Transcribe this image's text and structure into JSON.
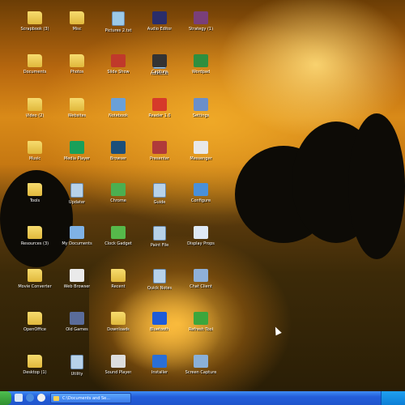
{
  "desktop": {
    "icons": [
      {
        "label": "Scrapbook (3)",
        "icon": "folder-icon",
        "color": "#e9c34b"
      },
      {
        "label": "Misc",
        "icon": "folder-icon",
        "color": "#e9c34b"
      },
      {
        "label": "Pictures 2.txt",
        "icon": "document-icon",
        "color": "#9cc9e8"
      },
      {
        "label": "Audio Editor",
        "icon": "app-icon",
        "color": "#2a2d6a"
      },
      {
        "label": "Strategy (1)",
        "icon": "app-icon",
        "color": "#7a3f7a"
      },
      {
        "label": "Documents",
        "icon": "folder-icon",
        "color": "#e9c34b"
      },
      {
        "label": "Photos",
        "icon": "folder-icon",
        "color": "#e9c34b"
      },
      {
        "label": "Slide Show",
        "icon": "app-icon",
        "color": "#c0392b"
      },
      {
        "label": "notes.txt",
        "icon": "document-icon",
        "color": "#9cc9e8"
      },
      {
        "label": "Capture",
        "icon": "app-icon",
        "color": "#333333"
      },
      {
        "label": "Wordpad",
        "icon": "app-icon",
        "color": "#2f8f3f"
      },
      {
        "label": "Video (2)",
        "icon": "folder-icon",
        "color": "#e9c34b"
      },
      {
        "label": "Websites",
        "icon": "folder-icon",
        "color": "#e9c34b"
      },
      {
        "label": "Notebook",
        "icon": "app-icon",
        "color": "#6aa0d8"
      },
      {
        "label": "Reader 1.0",
        "icon": "app-icon",
        "color": "#d63a2a"
      },
      {
        "label": "Settings",
        "icon": "app-icon",
        "color": "#6b8fc9"
      },
      {
        "label": "Music",
        "icon": "folder-icon",
        "color": "#e9c34b"
      },
      {
        "label": "Media Player",
        "icon": "app-icon",
        "color": "#18a05a"
      },
      {
        "label": "Browser",
        "icon": "app-icon",
        "color": "#1b4f7a"
      },
      {
        "label": "Presenter",
        "icon": "app-icon",
        "color": "#b03a3a"
      },
      {
        "label": "Messenger",
        "icon": "app-icon",
        "color": "#e8e8e8"
      },
      {
        "label": "Tools",
        "icon": "folder-icon",
        "color": "#e9c34b"
      },
      {
        "label": "Updater",
        "icon": "document-icon",
        "color": "#b7d2ea"
      },
      {
        "label": "Chrome",
        "icon": "app-icon",
        "color": "#4caf50"
      },
      {
        "label": "Guide",
        "icon": "document-icon",
        "color": "#b7d2ea"
      },
      {
        "label": "Configure",
        "icon": "app-icon",
        "color": "#4a90d9"
      },
      {
        "label": "Resources (3)",
        "icon": "folder-icon",
        "color": "#e9c34b"
      },
      {
        "label": "My Documents",
        "icon": "app-icon",
        "color": "#7fb2e5"
      },
      {
        "label": "Clock Gadget",
        "icon": "app-icon",
        "color": "#56b84a"
      },
      {
        "label": "Paint File",
        "icon": "document-icon",
        "color": "#b7d2ea"
      },
      {
        "label": "Display Props",
        "icon": "app-icon",
        "color": "#dfe9f5"
      },
      {
        "label": "Movie Converter",
        "icon": "folder-icon",
        "color": "#e9c34b"
      },
      {
        "label": "Web Browser",
        "icon": "app-icon",
        "color": "#eaeaea"
      },
      {
        "label": "Recent",
        "icon": "folder-icon",
        "color": "#e9c34b"
      },
      {
        "label": "Quick Notes",
        "icon": "document-icon",
        "color": "#b7d2ea"
      },
      {
        "label": "Chat Client",
        "icon": "app-icon",
        "color": "#8fb0d8"
      },
      {
        "label": "OpenOffice",
        "icon": "folder-icon",
        "color": "#e9c34b"
      },
      {
        "label": "Old Games",
        "icon": "app-icon",
        "color": "#5a6c9a"
      },
      {
        "label": "Downloads",
        "icon": "folder-icon",
        "color": "#e9c34b"
      },
      {
        "label": "Bluetooth",
        "icon": "app-icon",
        "color": "#1e5bd8"
      },
      {
        "label": "Refresh Tool",
        "icon": "app-icon",
        "color": "#3ca63c"
      },
      {
        "label": "Desktop (1)",
        "icon": "folder-icon",
        "color": "#e9c34b"
      },
      {
        "label": "Utility",
        "icon": "document-icon",
        "color": "#b7d2ea"
      },
      {
        "label": "Sound Player",
        "icon": "app-icon",
        "color": "#dddddd"
      },
      {
        "label": "Installer",
        "icon": "app-icon",
        "color": "#2a6fd6"
      },
      {
        "label": "Screen Capture",
        "icon": "app-icon",
        "color": "#8ab0d8"
      }
    ]
  },
  "taskbar": {
    "start_color": "#3aa83a",
    "quick_launch": [
      {
        "icon": "desktop-icon",
        "color": "#d8e6f7"
      },
      {
        "icon": "browser-icon",
        "color": "#4a8be0"
      },
      {
        "icon": "search-icon",
        "color": "#f0f0f0"
      }
    ],
    "window_button": "C:\\Documents and Se..."
  }
}
